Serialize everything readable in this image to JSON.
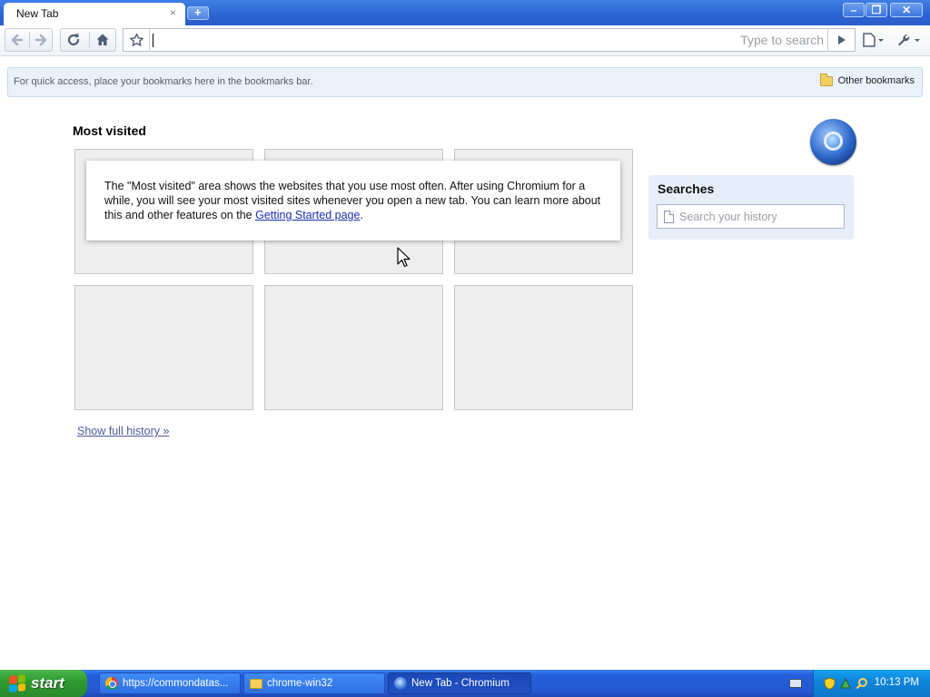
{
  "browser": {
    "tab_title": "New Tab",
    "tab_close": "×",
    "new_tab": "+",
    "window_buttons": {
      "minimize": "–",
      "restore": "❐",
      "close": "✕"
    }
  },
  "toolbar": {
    "back_icon": "arrow-left",
    "forward_icon": "arrow-right",
    "reload_icon": "reload",
    "home_icon": "home",
    "star_icon": "star",
    "omnibox_value": "",
    "omnibox_placeholder": "Type to search",
    "go_icon": "play-triangle",
    "page_menu_icon": "page-menu",
    "wrench_menu_icon": "wrench"
  },
  "bookmarks_bar": {
    "hint": "For quick access, place your bookmarks here in the bookmarks bar.",
    "other_bookmarks": "Other bookmarks"
  },
  "most_visited": {
    "title": "Most visited",
    "notice_text": "The \"Most visited\" area shows the websites that you use most often. After using Chromium for a while, you will see your most visited sites whenever you open a new tab. You can learn more about this and other features on the ",
    "notice_link": "Getting Started page",
    "notice_end": ".",
    "show_history": "Show full history »"
  },
  "searches": {
    "title": "Searches",
    "placeholder": "Search your history",
    "value": ""
  },
  "taskbar": {
    "start_label": "start",
    "items": [
      {
        "label": "https://commondatas...",
        "icon": "chrome-icon",
        "active": false
      },
      {
        "label": "chrome-win32",
        "icon": "folder-icon",
        "active": false
      },
      {
        "label": "New Tab - Chromium",
        "icon": "chromium-icon",
        "active": true
      }
    ],
    "clock": "10:13 PM"
  }
}
